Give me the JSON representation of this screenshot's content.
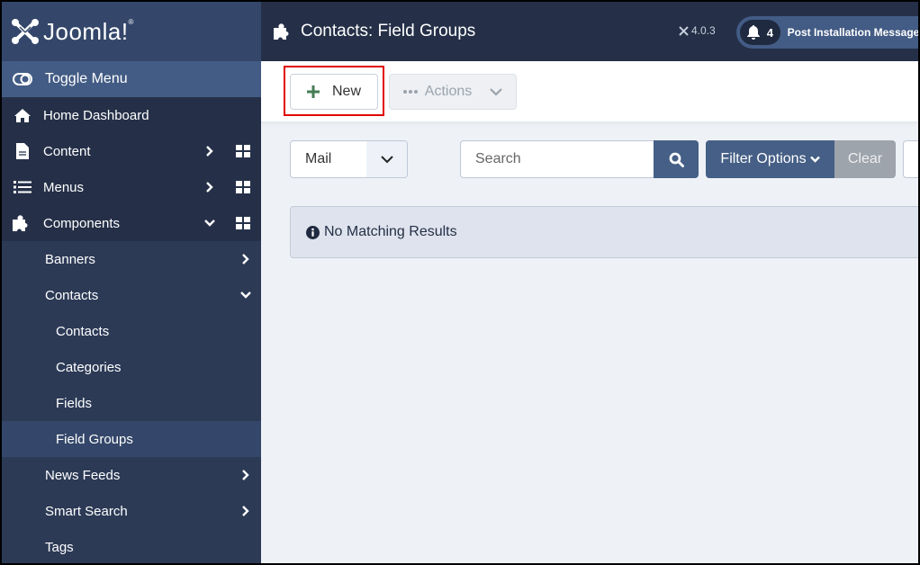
{
  "brand": {
    "name": "Joomla!",
    "logo_icon": "joomla-logo-icon"
  },
  "sidebar": {
    "toggle_label": "Toggle Menu",
    "items": [
      {
        "label": "Home Dashboard",
        "icon": "home-icon"
      },
      {
        "label": "Content",
        "icon": "file-icon",
        "expand": "chevron-right",
        "dashboard": true
      },
      {
        "label": "Menus",
        "icon": "list-icon",
        "expand": "chevron-right",
        "dashboard": true
      },
      {
        "label": "Components",
        "icon": "puzzle-icon",
        "expand": "chevron-down",
        "dashboard": true
      }
    ],
    "components": [
      {
        "label": "Banners",
        "expand": "chevron-right"
      },
      {
        "label": "Contacts",
        "expand": "chevron-down",
        "children": [
          {
            "label": "Contacts"
          },
          {
            "label": "Categories"
          },
          {
            "label": "Fields"
          },
          {
            "label": "Field Groups",
            "active": true
          }
        ]
      },
      {
        "label": "News Feeds",
        "expand": "chevron-right"
      },
      {
        "label": "Smart Search",
        "expand": "chevron-right"
      },
      {
        "label": "Tags"
      }
    ]
  },
  "header": {
    "title": "Contacts: Field Groups",
    "version": "4.0.3",
    "notification_count": "4",
    "post_install_label": "Post Installation Messages"
  },
  "toolbar": {
    "new_label": "New",
    "actions_label": "Actions"
  },
  "filters": {
    "context_select_value": "Mail",
    "search_placeholder": "Search",
    "filter_options_label": "Filter Options",
    "clear_label": "Clear"
  },
  "alert": {
    "message": "No Matching Results"
  },
  "colors": {
    "sidebar_bg": "#253048",
    "brand_bg": "#34476a",
    "toggle_bg": "#435c85",
    "primary": "#455f86",
    "clear_bg": "#9ea4ac",
    "new_plus": "#457d54",
    "highlight": "#e00000",
    "page_bg": "#eef1f6"
  }
}
